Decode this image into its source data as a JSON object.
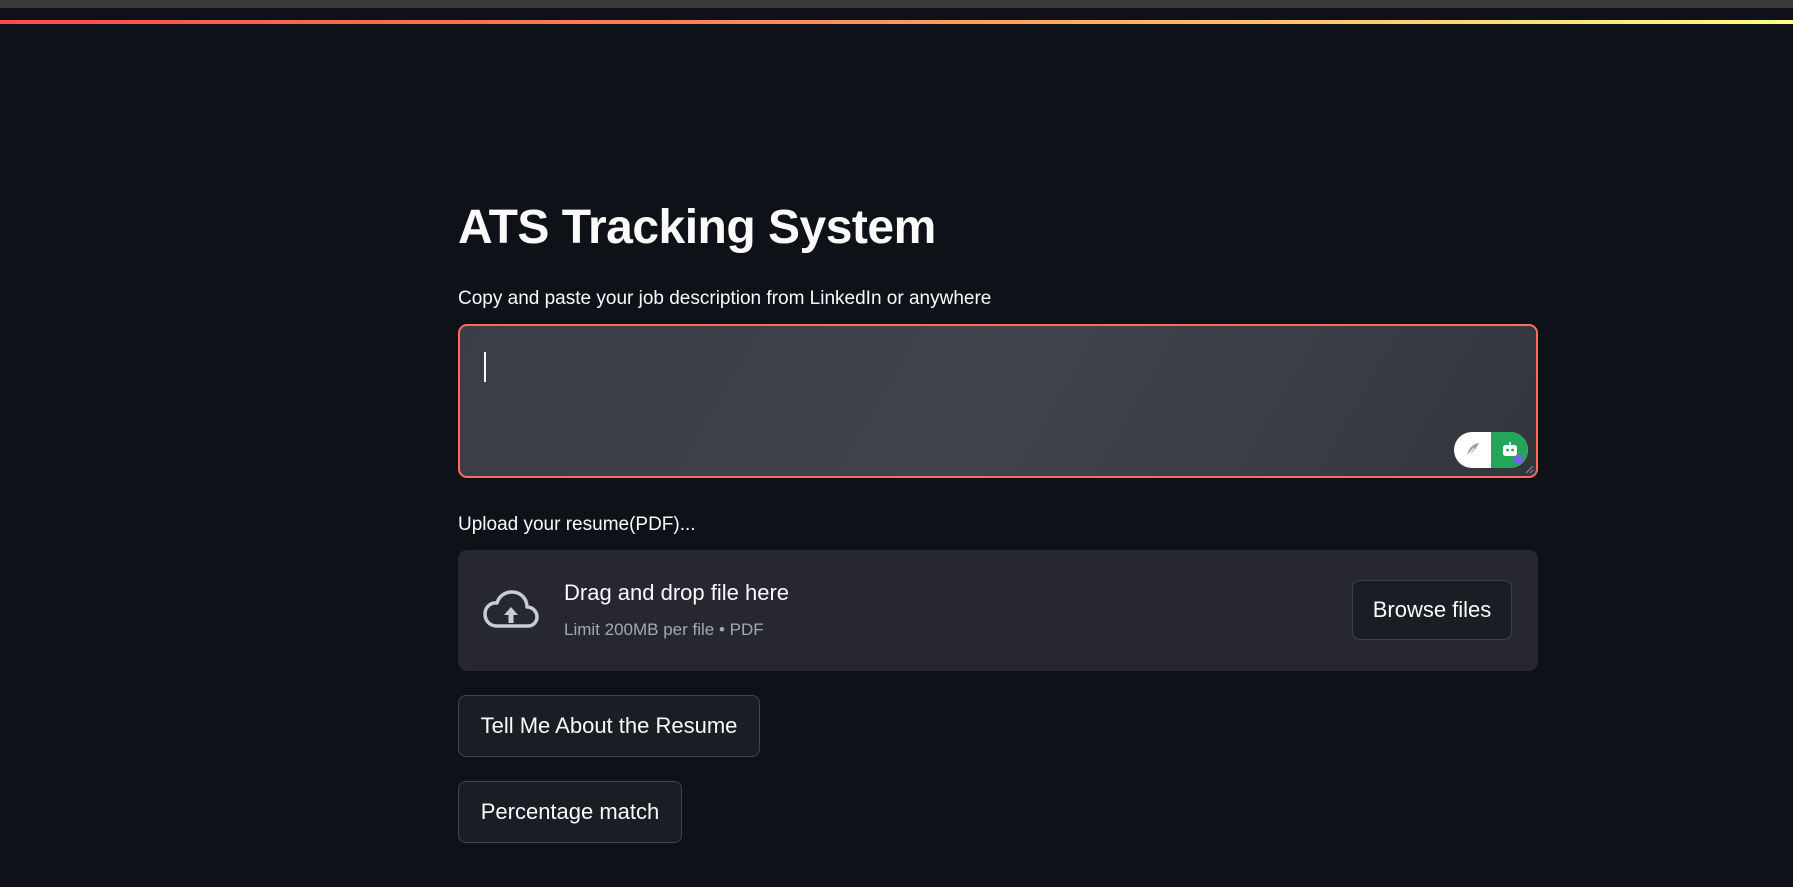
{
  "page": {
    "title": "ATS Tracking System"
  },
  "job_description": {
    "label": "Copy and paste your job description from LinkedIn or anywhere",
    "value": "",
    "placeholder": ""
  },
  "resume_upload": {
    "label": "Upload your resume(PDF)...",
    "drop_title": "Drag and drop file here",
    "drop_subtitle": "Limit 200MB per file • PDF",
    "browse_label": "Browse files"
  },
  "actions": {
    "tell_me_label": "Tell Me About the Resume",
    "percentage_label": "Percentage match"
  },
  "colors": {
    "background": "#0e1117",
    "accent": "#ff4b4b",
    "focus_border": "#ff6b57",
    "input_bg": "#262730",
    "extension_green": "#23a55a"
  },
  "icons": {
    "upload": "cloud-upload-icon",
    "extension_left": "feather-icon",
    "extension_right": "robot-icon"
  }
}
